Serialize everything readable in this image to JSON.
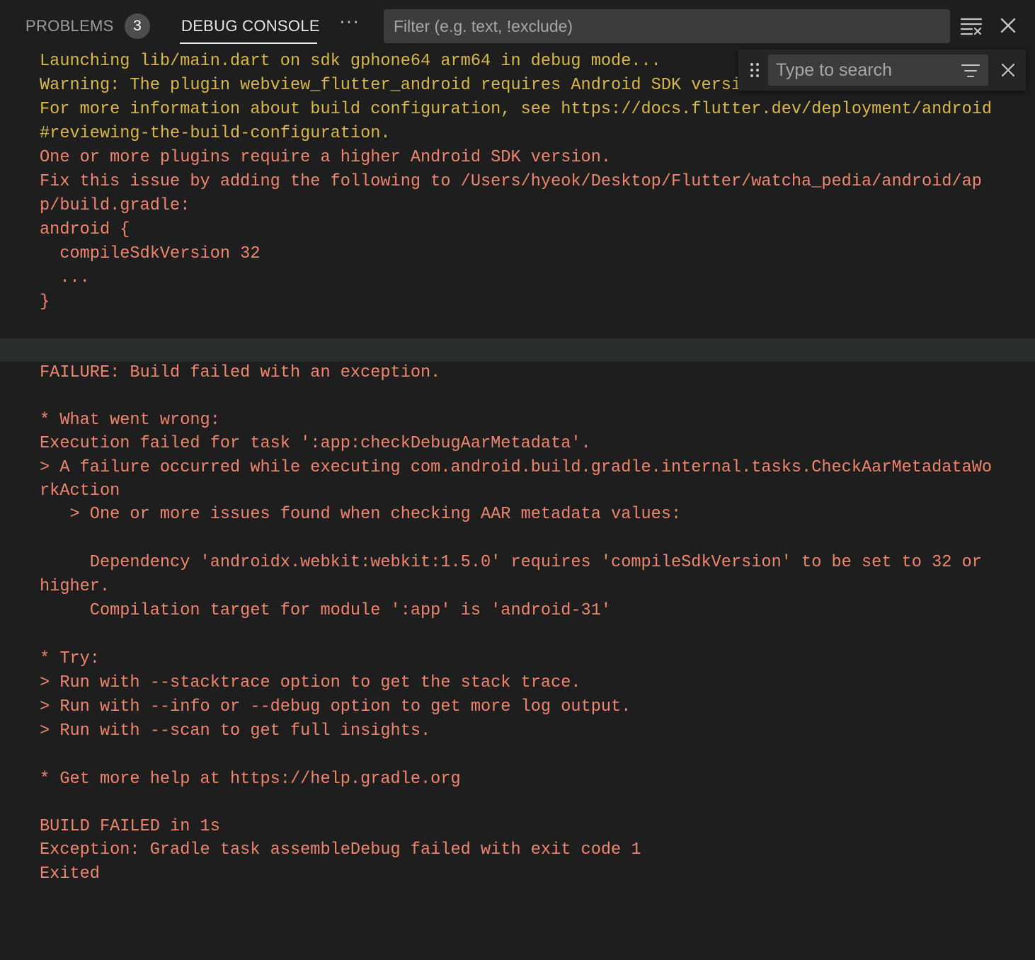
{
  "panel": {
    "tabs": [
      {
        "label": "PROBLEMS",
        "badge": "3"
      },
      {
        "label": "DEBUG CONSOLE"
      }
    ],
    "more_label": "···",
    "filter_placeholder": "Filter (e.g. text, !exclude)",
    "icons": {
      "clear_console": "clear-all-icon",
      "close_panel": "close-icon"
    }
  },
  "find_widget": {
    "placeholder": "Type to search",
    "icons": {
      "grip": "grip-icon",
      "filter": "filter-icon",
      "close": "close-icon"
    }
  },
  "console": {
    "lines": [
      "Launching lib/main.dart on sdk gphone64 arm64 in debug mode...",
      "Warning: The plugin webview_flutter_android requires Android SDK version 32.",
      "For more information about build configuration, see https://docs.flutter.dev/deployment/android",
      "#reviewing-the-build-configuration.",
      "One or more plugins require a higher Android SDK version.",
      "Fix this issue by adding the following to /Users/hyeok/Desktop/Flutter/watcha_pedia/android/ap",
      "p/build.gradle:",
      "android {",
      "  compileSdkVersion 32",
      "  ...",
      "}",
      "FAILURE: Build failed with an exception.",
      "* What went wrong:",
      "Execution failed for task ':app:checkDebugAarMetadata'.",
      "> A failure occurred while executing com.android.build.gradle.internal.tasks.CheckAarMetadataWo",
      "rkAction",
      "   > One or more issues found when checking AAR metadata values:",
      "     Dependency 'androidx.webkit:webkit:1.5.0' requires 'compileSdkVersion' to be set to 32 or",
      "higher.",
      "     Compilation target for module ':app' is 'android-31'",
      "* Try:",
      "> Run with --stacktrace option to get the stack trace.",
      "> Run with --info or --debug option to get more log output.",
      "> Run with --scan to get full insights.",
      "* Get more help at https://help.gradle.org",
      "BUILD FAILED in 1s",
      "Exception: Gradle task assembleDebug failed with exit code 1",
      "Exited"
    ]
  },
  "colors": {
    "background": "#1e1e1e",
    "warning_text": "#d9b84b",
    "error_text": "#f0856f",
    "separator": "#2a2d2e"
  }
}
